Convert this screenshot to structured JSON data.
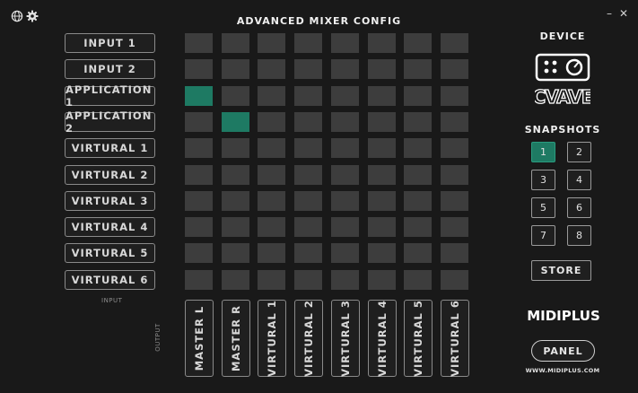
{
  "title": "ADVANCED MIXER CONFIG",
  "window": {
    "minimize": "–",
    "close": "✕"
  },
  "icons": {
    "globe": "globe-icon",
    "settings": "gear-icon"
  },
  "inputs": [
    "INPUT 1",
    "INPUT 2",
    "APPLICATION 1",
    "APPLICATION 2",
    "VIRTURAL 1",
    "VIRTURAL 2",
    "VIRTURAL 3",
    "VIRTURAL 4",
    "VIRTURAL 5",
    "VIRTURAL 6"
  ],
  "outputs": [
    "MASTER L",
    "MASTER R",
    "VIRTURAL 1",
    "VIRTURAL 2",
    "VIRTURAL 3",
    "VIRTURAL 4",
    "VIRTURAL 5",
    "VIRTURAL 6"
  ],
  "matrix_active": [
    [
      2,
      0
    ],
    [
      3,
      1
    ]
  ],
  "labels": {
    "input": "INPUT",
    "output": "OUTPUT"
  },
  "device": {
    "heading": "DEVICE",
    "model": "CVAVE"
  },
  "snapshots": {
    "heading": "SNAPSHOTS",
    "items": [
      "1",
      "2",
      "3",
      "4",
      "5",
      "6",
      "7",
      "8"
    ],
    "active": "1",
    "store_label": "STORE"
  },
  "brand": "MIDIPLUS",
  "panel_label": "PANEL",
  "website": "WWW.MIDIPLUS.COM",
  "colors": {
    "background": "#191919",
    "cell": "#3d3d3d",
    "active": "#1e7a63"
  }
}
